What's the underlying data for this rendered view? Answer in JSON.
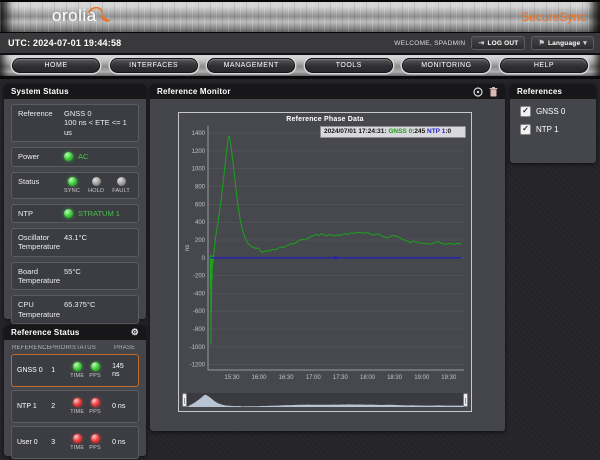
{
  "header": {
    "brand": "orolia",
    "product": "SecureSync",
    "utc_time": "UTC: 2024-07-01 19:44:58",
    "welcome": "WELCOME, SPADMIN",
    "logout_label": "LOG OUT",
    "language_label": "Language"
  },
  "nav": {
    "items": [
      {
        "label": "HOME"
      },
      {
        "label": "INTERFACES"
      },
      {
        "label": "MANAGEMENT"
      },
      {
        "label": "TOOLS"
      },
      {
        "label": "MONITORING"
      },
      {
        "label": "HELP"
      }
    ]
  },
  "system_status": {
    "title": "System Status",
    "reference": {
      "label": "Reference",
      "line1": "GNSS 0",
      "line2": "100 ns < ETE <= 1 us"
    },
    "power": {
      "label": "Power",
      "value": "AC",
      "led": "green"
    },
    "status": {
      "label": "Status",
      "leds": [
        {
          "label": "SYNC",
          "state": "green"
        },
        {
          "label": "HOLD",
          "state": "gray"
        },
        {
          "label": "FAULT",
          "state": "gray"
        }
      ]
    },
    "ntp": {
      "label": "NTP",
      "value": "STRATUM 1",
      "led": "green"
    },
    "osc_temp": {
      "label": "Oscillator Temperature",
      "value": "43.1°C"
    },
    "board_temp": {
      "label": "Board Temperature",
      "value": "55°C"
    },
    "cpu_temp": {
      "label": "CPU Temperature",
      "value": "65.375°C"
    }
  },
  "reference_status": {
    "title": "Reference Status",
    "columns": {
      "c1": "REFERENCE",
      "c2": "PRIORITY",
      "c3": "STATUS",
      "c4": "PHASE"
    },
    "led_labels": {
      "time": "TIME",
      "pps": "PPS"
    },
    "rows": [
      {
        "reference": "GNSS 0",
        "priority": "1",
        "time": "green",
        "pps": "green",
        "phase": "145 ns",
        "highlighted": true
      },
      {
        "reference": "NTP 1",
        "priority": "2",
        "time": "red",
        "pps": "red",
        "phase": "0 ns",
        "highlighted": false
      },
      {
        "reference": "User 0",
        "priority": "3",
        "time": "red",
        "pps": "red",
        "phase": "0 ns",
        "highlighted": false
      }
    ]
  },
  "references_panel": {
    "title": "References",
    "items": [
      {
        "label": "GNSS 0",
        "checked": true,
        "check_glyph": "✓"
      },
      {
        "label": "NTP 1",
        "checked": true,
        "check_glyph": "✓"
      }
    ]
  },
  "reference_monitor": {
    "title": "Reference Monitor"
  },
  "colors": {
    "accent_orange": "#f2701d",
    "green_series": "#17a617",
    "blue_series": "#2222b2",
    "led_green": "#41d23e",
    "led_red": "#ef4040",
    "panel_bg": "#45464c",
    "title_bar": "#17171a",
    "navigator_fill": "#b9c4d3"
  },
  "chart_data": {
    "type": "line",
    "title": "Reference Phase Data",
    "ylabel": "ns",
    "xlim": [
      15.06,
      19.78
    ],
    "ylim": [
      -1260,
      1480
    ],
    "grid": "horizontal",
    "legend_position": "tooltip-top-right",
    "yticks": [
      1400,
      1200,
      1000,
      800,
      600,
      400,
      200,
      0,
      -200,
      -400,
      -600,
      -800,
      -1000,
      -1200
    ],
    "xticks": [
      {
        "v": 15.5,
        "label": "15:30"
      },
      {
        "v": 16.0,
        "label": "16:00"
      },
      {
        "v": 16.5,
        "label": "16:30"
      },
      {
        "v": 17.0,
        "label": "17:00"
      },
      {
        "v": 17.5,
        "label": "17:30"
      },
      {
        "v": 18.0,
        "label": "18:00"
      },
      {
        "v": 18.5,
        "label": "18:30"
      },
      {
        "v": 19.0,
        "label": "19:00"
      },
      {
        "v": 19.5,
        "label": "19:30"
      }
    ],
    "tooltip": {
      "timestamp": "2024/07/01 17:24:31:",
      "gnss_label": "GNSS 0",
      "gnss_value": ":245",
      "ntp_label": "NTP 1",
      "ntp_value": ":0"
    },
    "series": [
      {
        "name": "GNSS 0",
        "color": "#17a617",
        "width": 1,
        "points": [
          [
            15.1,
            30
          ],
          [
            15.105,
            -350
          ],
          [
            15.11,
            20
          ],
          [
            15.115,
            -970
          ],
          [
            15.12,
            10
          ],
          [
            15.125,
            -600
          ],
          [
            15.13,
            15
          ],
          [
            15.135,
            -250
          ],
          [
            15.14,
            25
          ],
          [
            15.15,
            -80
          ],
          [
            15.16,
            10
          ],
          [
            15.2,
            230
          ],
          [
            15.25,
            420
          ],
          [
            15.3,
            640
          ],
          [
            15.35,
            900
          ],
          [
            15.4,
            1180
          ],
          [
            15.43,
            1340
          ],
          [
            15.45,
            1370
          ],
          [
            15.48,
            1280
          ],
          [
            15.52,
            1080
          ],
          [
            15.56,
            860
          ],
          [
            15.6,
            640
          ],
          [
            15.65,
            440
          ],
          [
            15.7,
            300
          ],
          [
            15.75,
            215
          ],
          [
            15.8,
            160
          ],
          [
            15.85,
            130
          ],
          [
            15.9,
            115
          ],
          [
            15.95,
            105
          ],
          [
            16.0,
            110
          ],
          [
            16.03,
            80
          ],
          [
            16.06,
            60
          ],
          [
            16.1,
            75
          ],
          [
            16.13,
            65
          ],
          [
            16.16,
            85
          ],
          [
            16.2,
            75
          ],
          [
            16.25,
            95
          ],
          [
            16.3,
            90
          ],
          [
            16.35,
            105
          ],
          [
            16.4,
            120
          ],
          [
            16.45,
            115
          ],
          [
            16.5,
            135
          ],
          [
            16.55,
            145
          ],
          [
            16.6,
            160
          ],
          [
            16.65,
            155
          ],
          [
            16.7,
            180
          ],
          [
            16.75,
            195
          ],
          [
            16.8,
            210
          ],
          [
            16.85,
            200
          ],
          [
            16.9,
            220
          ],
          [
            16.95,
            235
          ],
          [
            17.0,
            250
          ],
          [
            17.05,
            262
          ],
          [
            17.1,
            252
          ],
          [
            17.15,
            268
          ],
          [
            17.2,
            258
          ],
          [
            17.25,
            245
          ],
          [
            17.3,
            262
          ],
          [
            17.35,
            252
          ],
          [
            17.4,
            246
          ],
          [
            17.45,
            258
          ],
          [
            17.5,
            250
          ],
          [
            17.55,
            264
          ],
          [
            17.6,
            272
          ],
          [
            17.65,
            262
          ],
          [
            17.7,
            282
          ],
          [
            17.75,
            272
          ],
          [
            17.8,
            288
          ],
          [
            17.85,
            278
          ],
          [
            17.9,
            284
          ],
          [
            17.95,
            274
          ],
          [
            18.0,
            284
          ],
          [
            18.05,
            268
          ],
          [
            18.1,
            255
          ],
          [
            18.15,
            265
          ],
          [
            18.2,
            268
          ],
          [
            18.25,
            252
          ],
          [
            18.3,
            235
          ],
          [
            18.35,
            226
          ],
          [
            18.4,
            232
          ],
          [
            18.45,
            244
          ],
          [
            18.5,
            250
          ],
          [
            18.55,
            236
          ],
          [
            18.6,
            224
          ],
          [
            18.65,
            206
          ],
          [
            18.7,
            196
          ],
          [
            18.75,
            182
          ],
          [
            18.8,
            172
          ],
          [
            18.85,
            186
          ],
          [
            18.9,
            176
          ],
          [
            18.95,
            170
          ],
          [
            19.0,
            166
          ],
          [
            19.05,
            156
          ],
          [
            19.1,
            162
          ],
          [
            19.15,
            152
          ],
          [
            19.2,
            162
          ],
          [
            19.25,
            172
          ],
          [
            19.3,
            182
          ],
          [
            19.35,
            166
          ],
          [
            19.4,
            156
          ],
          [
            19.45,
            152
          ],
          [
            19.5,
            162
          ],
          [
            19.55,
            156
          ],
          [
            19.6,
            152
          ],
          [
            19.65,
            162
          ],
          [
            19.7,
            158
          ],
          [
            19.73,
            162
          ]
        ]
      },
      {
        "name": "NTP 1",
        "color": "#2222b2",
        "width": 1.3,
        "points": [
          [
            15.1,
            0
          ],
          [
            19.73,
            0
          ]
        ],
        "marker": [
          17.41,
          0
        ]
      }
    ]
  }
}
